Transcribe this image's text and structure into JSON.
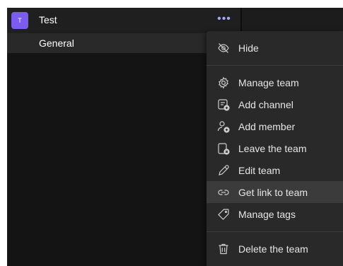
{
  "team": {
    "avatar_initial": "T",
    "name": "Test",
    "more_label": "•••"
  },
  "channels": [
    {
      "label": "General"
    }
  ],
  "menu": {
    "items": [
      {
        "label": "Hide",
        "icon": "hide-icon"
      },
      {
        "label": "Manage team",
        "icon": "gear-icon"
      },
      {
        "label": "Add channel",
        "icon": "add-channel-icon"
      },
      {
        "label": "Add member",
        "icon": "add-member-icon"
      },
      {
        "label": "Leave the team",
        "icon": "leave-team-icon"
      },
      {
        "label": "Edit team",
        "icon": "pencil-icon"
      },
      {
        "label": "Get link to team",
        "icon": "link-icon",
        "highlighted": true
      },
      {
        "label": "Manage tags",
        "icon": "tag-icon"
      },
      {
        "label": "Delete the team",
        "icon": "trash-icon"
      }
    ]
  },
  "colors": {
    "accent": "#7a5cf0",
    "more_button": "#a6a7ff",
    "menu_background": "#292929",
    "hover": "#3b3b3b"
  }
}
